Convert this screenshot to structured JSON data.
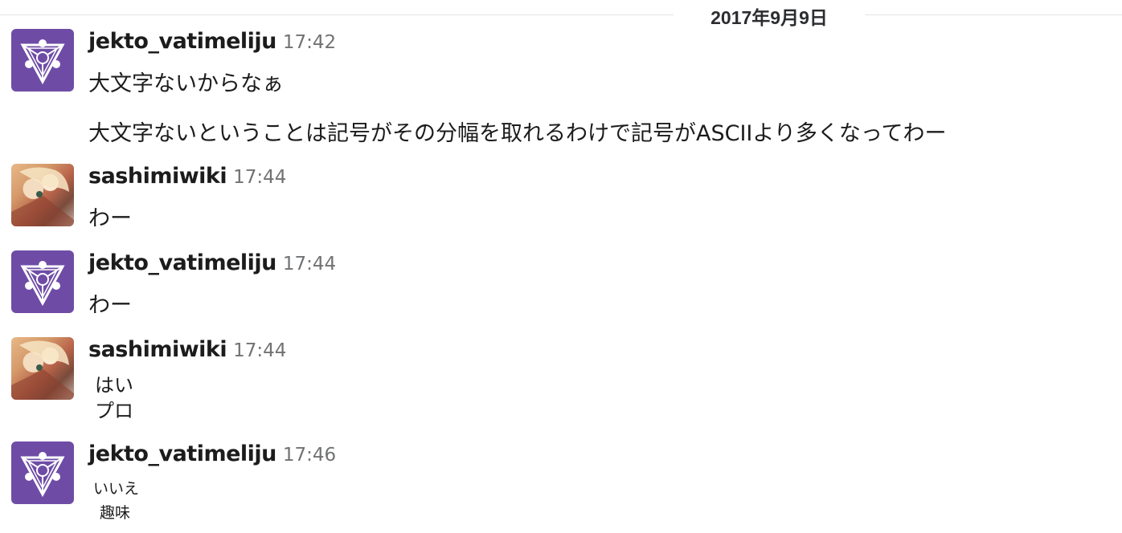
{
  "date_divider": "2017年9月9日",
  "messages": [
    {
      "user": "jekto_vatimeliju",
      "time": "17:42",
      "avatar": "triangle-logo-avatar",
      "lines": [
        "大文字ないからなぁ",
        "大文字ないということは記号がその分幅を取れるわけで記号がASCIIより多くなってわー"
      ]
    },
    {
      "user": "sashimiwiki",
      "time": "17:44",
      "avatar": "anime-character-avatar",
      "lines": [
        "わー"
      ]
    },
    {
      "user": "jekto_vatimeliju",
      "time": "17:44",
      "avatar": "triangle-logo-avatar",
      "lines": [
        "わー"
      ]
    },
    {
      "user": "sashimiwiki",
      "time": "17:44",
      "avatar": "anime-character-avatar",
      "lines": [
        "はい",
        "プロ"
      ]
    },
    {
      "user": "jekto_vatimeliju",
      "time": "17:46",
      "avatar": "triangle-logo-avatar",
      "lines": [
        "いいえ",
        "趣味"
      ]
    }
  ],
  "colors": {
    "avatar_purple": "#6e4ca6",
    "timestamp": "#717274",
    "divider": "#e4e4e4"
  }
}
